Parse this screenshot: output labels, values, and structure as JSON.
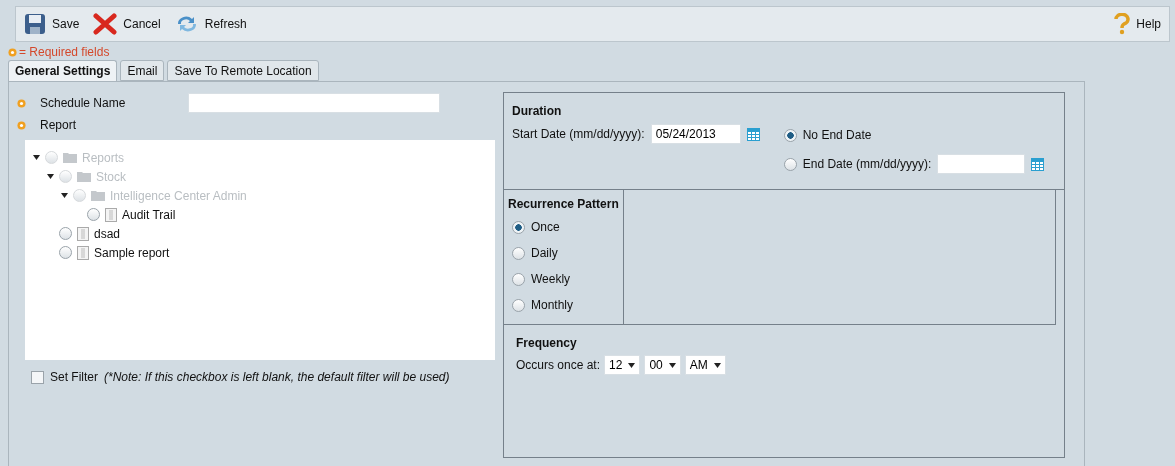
{
  "toolbar": {
    "buttons": [
      {
        "kind": "save",
        "label": "Save"
      },
      {
        "kind": "cancel",
        "label": "Cancel"
      },
      {
        "kind": "refresh",
        "label": "Refresh"
      }
    ],
    "help": {
      "label": "Help"
    }
  },
  "required_note": "= Required fields",
  "tabs": [
    {
      "label": "General Settings",
      "selected": true
    },
    {
      "label": "Email",
      "selected": false
    },
    {
      "label": "Save To Remote Location",
      "selected": false
    }
  ],
  "schedule_name": {
    "label": "Schedule Name"
  },
  "report": {
    "label": "Report",
    "tree": [
      {
        "kind": "folder",
        "label": "Reports",
        "disabled": true,
        "expanded": true,
        "selected": false,
        "children": [
          {
            "kind": "folder",
            "label": "Stock",
            "disabled": true,
            "expanded": true,
            "selected": false,
            "children": [
              {
                "kind": "folder",
                "label": "Intelligence Center Admin",
                "disabled": true,
                "expanded": true,
                "selected": false,
                "children": [
                  {
                    "kind": "report",
                    "label": "Audit Trail",
                    "disabled": false,
                    "selected": false
                  }
                ]
              }
            ]
          },
          {
            "kind": "report",
            "label": "dsad",
            "disabled": false,
            "selected": false
          },
          {
            "kind": "report",
            "label": "Sample report",
            "disabled": false,
            "selected": false
          }
        ]
      }
    ]
  },
  "set_filter": {
    "label": "Set Filter",
    "checked": false,
    "note": "(*Note: If this checkbox is left blank, the default filter will be used)"
  },
  "duration": {
    "title": "Duration",
    "start_label": "Start Date (mm/dd/yyyy):",
    "start_value": "05/24/2013",
    "end_options": [
      {
        "label": "No End Date",
        "selected": true,
        "kind": "plain"
      },
      {
        "label": "End Date (mm/dd/yyyy):",
        "selected": false,
        "kind": "date"
      }
    ]
  },
  "recurrence": {
    "title": "Recurrence Pattern",
    "options": [
      {
        "label": "Once",
        "selected": true
      },
      {
        "label": "Daily",
        "selected": false
      },
      {
        "label": "Weekly",
        "selected": false
      },
      {
        "label": "Monthly",
        "selected": false
      }
    ]
  },
  "frequency": {
    "title": "Frequency",
    "label": "Occurs once at:",
    "selects": [
      "12",
      "00",
      "AM"
    ]
  }
}
